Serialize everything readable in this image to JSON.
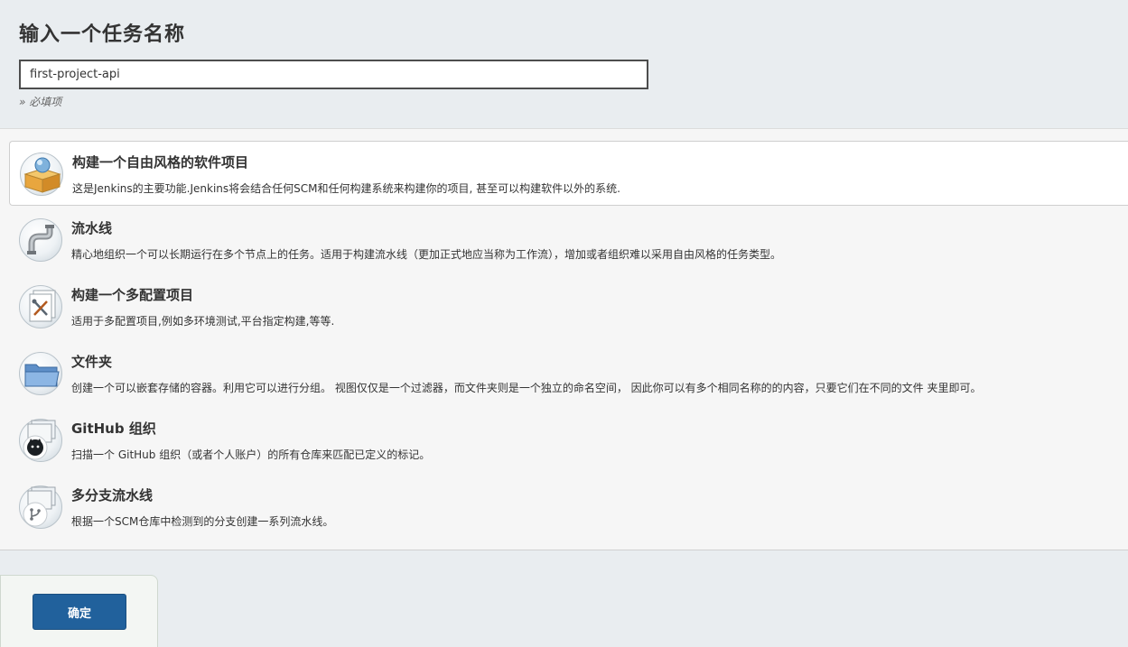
{
  "page": {
    "title": "输入一个任务名称",
    "name_input_value": "first-project-api",
    "required_note": "» 必填项"
  },
  "items": [
    {
      "title": "构建一个自由风格的软件项目",
      "description": "这是Jenkins的主要功能.Jenkins将会结合任何SCM和任何构建系统来构建你的项目, 甚至可以构建软件以外的系统.",
      "icon": "freestyle-box-icon",
      "selected": true
    },
    {
      "title": "流水线",
      "description": "精心地组织一个可以长期运行在多个节点上的任务。适用于构建流水线（更加正式地应当称为工作流），增加或者组织难以采用自由风格的任务类型。",
      "icon": "pipeline-icon",
      "selected": false
    },
    {
      "title": "构建一个多配置项目",
      "description": "适用于多配置项目,例如多环境测试,平台指定构建,等等.",
      "icon": "multi-config-icon",
      "selected": false
    },
    {
      "title": "文件夹",
      "description": "创建一个可以嵌套存储的容器。利用它可以进行分组。 视图仅仅是一个过滤器，而文件夹则是一个独立的命名空间， 因此你可以有多个相同名称的的内容，只要它们在不同的文件 夹里即可。",
      "icon": "folder-icon",
      "selected": false
    },
    {
      "title": "GitHub 组织",
      "description": "扫描一个 GitHub 组织（或者个人账户）的所有仓库来匹配已定义的标记。",
      "icon": "github-org-icon",
      "selected": false
    },
    {
      "title": "多分支流水线",
      "description": "根据一个SCM仓库中检测到的分支创建一系列流水线。",
      "icon": "multibranch-icon",
      "selected": false
    }
  ],
  "footer": {
    "ok_label": "确定"
  },
  "colors": {
    "button": "#21619c",
    "background": "#e9edf0",
    "panel": "#f6f6f6"
  }
}
